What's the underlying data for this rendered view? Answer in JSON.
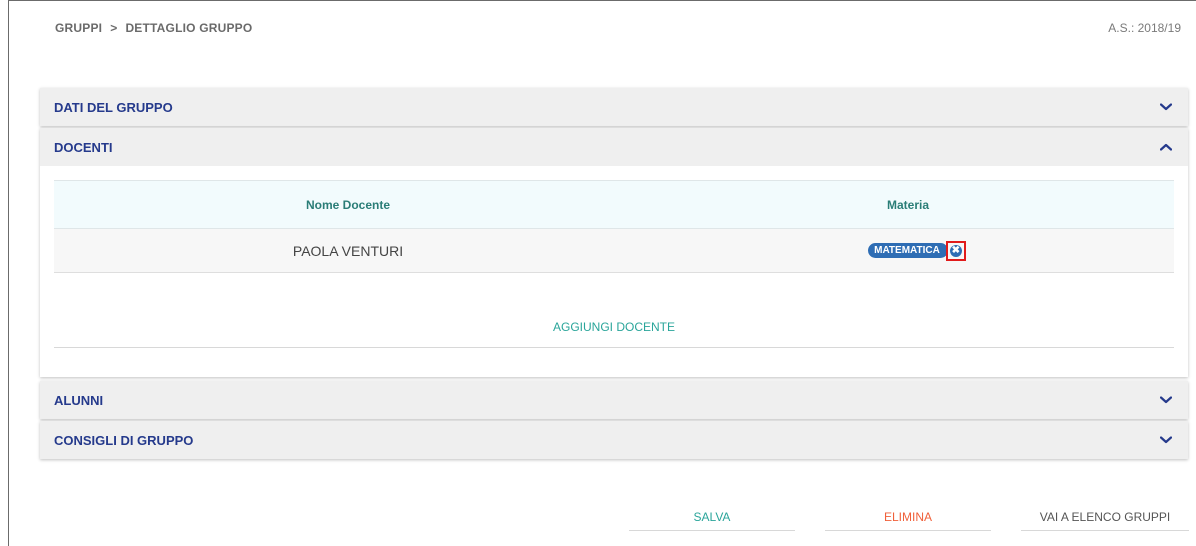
{
  "breadcrumb": {
    "root": "GRUPPI",
    "separator": ">",
    "current": "DETTAGLIO GRUPPO"
  },
  "school_year": "A.S.: 2018/19",
  "panels": {
    "dati": {
      "title": "DATI DEL GRUPPO",
      "icon": "chevron-down-icon"
    },
    "docenti": {
      "title": "DOCENTI",
      "icon": "chevron-up-icon",
      "table": {
        "headers": [
          "Nome Docente",
          "Materia"
        ],
        "rows": [
          {
            "name": "PAOLA VENTURI",
            "subject": "MATEMATICA"
          }
        ]
      },
      "add_label": "AGGIUNGI DOCENTE"
    },
    "alunni": {
      "title": "ALUNNI",
      "icon": "chevron-down-icon"
    },
    "consigli": {
      "title": "CONSIGLI DI GRUPPO",
      "icon": "chevron-down-icon"
    }
  },
  "actions": {
    "save": "SALVA",
    "delete": "ELIMINA",
    "back": "VAI A ELENCO GRUPPI"
  },
  "colors": {
    "title_blue": "#253a8c",
    "teal": "#2aa59a",
    "delete_orange": "#f0603a",
    "tag_blue": "#2e6db4",
    "highlight_red": "#e11b1b"
  }
}
